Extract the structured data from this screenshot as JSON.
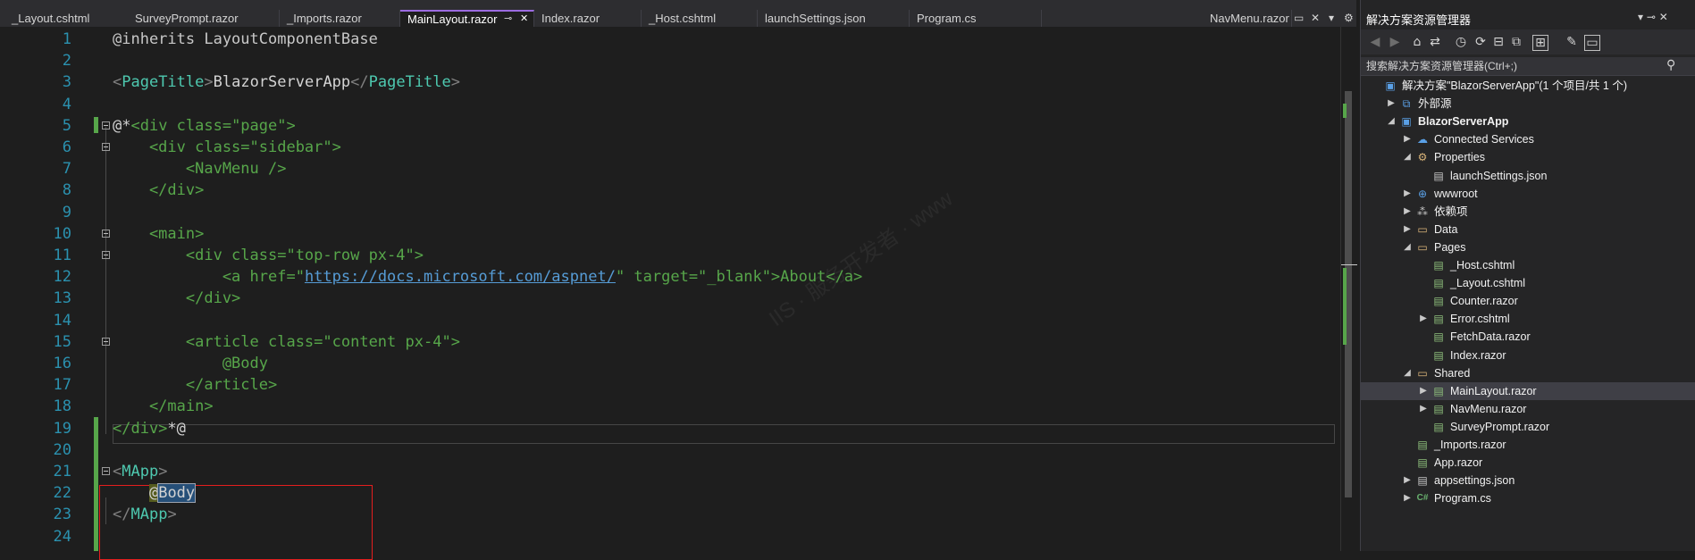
{
  "tabs": [
    {
      "label": "_Layout.cshtml",
      "active": false
    },
    {
      "label": "SurveyPrompt.razor",
      "active": false
    },
    {
      "label": "_Imports.razor",
      "active": false
    },
    {
      "label": "MainLayout.razor",
      "active": true
    },
    {
      "label": "Index.razor",
      "active": false
    },
    {
      "label": "_Host.cshtml",
      "active": false
    },
    {
      "label": "launchSettings.json",
      "active": false
    },
    {
      "label": "Program.cs",
      "active": false
    },
    {
      "label": "NavMenu.razor",
      "active": false
    }
  ],
  "tab_controls": {
    "pin": "⊸",
    "close": "✕",
    "float": "▭",
    "dropdown": "▾",
    "settings": "⚙"
  },
  "code_lines": [
    {
      "n": "1",
      "segs": [
        {
          "t": "@inherits LayoutComponentBase",
          "c": "t-kw"
        }
      ]
    },
    {
      "n": "2",
      "segs": []
    },
    {
      "n": "3",
      "segs": [
        {
          "t": "<",
          "c": "t-delim"
        },
        {
          "t": "PageTitle",
          "c": "t-comp"
        },
        {
          "t": ">",
          "c": "t-delim"
        },
        {
          "t": "BlazorServerApp",
          "c": "t-muted"
        },
        {
          "t": "</",
          "c": "t-delim"
        },
        {
          "t": "PageTitle",
          "c": "t-comp"
        },
        {
          "t": ">",
          "c": "t-delim"
        }
      ]
    },
    {
      "n": "4",
      "segs": []
    },
    {
      "n": "5",
      "segs": [
        {
          "t": "@*",
          "c": "t-muted"
        },
        {
          "t": "<div class=\"page\">",
          "c": "t-com"
        }
      ]
    },
    {
      "n": "6",
      "segs": [
        {
          "t": "    <div class=\"sidebar\">",
          "c": "t-com"
        }
      ]
    },
    {
      "n": "7",
      "segs": [
        {
          "t": "        <NavMenu />",
          "c": "t-com"
        }
      ]
    },
    {
      "n": "8",
      "segs": [
        {
          "t": "    </div>",
          "c": "t-com"
        }
      ]
    },
    {
      "n": "9",
      "segs": []
    },
    {
      "n": "10",
      "segs": [
        {
          "t": "    <main>",
          "c": "t-com"
        }
      ]
    },
    {
      "n": "11",
      "segs": [
        {
          "t": "        <div class=\"top-row px-4\">",
          "c": "t-com"
        }
      ]
    },
    {
      "n": "12",
      "segs": [
        {
          "t": "            <a href=\"",
          "c": "t-com"
        },
        {
          "t": "https://docs.microsoft.com/aspnet/",
          "c": "t-link"
        },
        {
          "t": "\" target=\"_blank\">About</a>",
          "c": "t-com"
        }
      ]
    },
    {
      "n": "13",
      "segs": [
        {
          "t": "        </div>",
          "c": "t-com"
        }
      ]
    },
    {
      "n": "14",
      "segs": []
    },
    {
      "n": "15",
      "segs": [
        {
          "t": "        <article class=\"content px-4\">",
          "c": "t-com"
        }
      ]
    },
    {
      "n": "16",
      "segs": [
        {
          "t": "            @Body",
          "c": "t-com"
        }
      ]
    },
    {
      "n": "17",
      "segs": [
        {
          "t": "        </article>",
          "c": "t-com"
        }
      ]
    },
    {
      "n": "18",
      "segs": [
        {
          "t": "    </main>",
          "c": "t-com"
        }
      ]
    },
    {
      "n": "19",
      "segs": [
        {
          "t": "</div>",
          "c": "t-com"
        },
        {
          "t": "*@",
          "c": "t-muted"
        }
      ]
    },
    {
      "n": "20",
      "segs": []
    },
    {
      "n": "21",
      "segs": [
        {
          "t": "<",
          "c": "t-delim"
        },
        {
          "t": "MApp",
          "c": "t-comp"
        },
        {
          "t": ">",
          "c": "t-delim"
        }
      ]
    },
    {
      "n": "22",
      "segs": [
        {
          "t": "    ",
          "c": "t-muted"
        },
        {
          "t": "@",
          "c": "t-atbg"
        },
        {
          "t": "Body",
          "c": "t-sel"
        }
      ]
    },
    {
      "n": "23",
      "segs": [
        {
          "t": "</",
          "c": "t-delim"
        },
        {
          "t": "MApp",
          "c": "t-comp"
        },
        {
          "t": ">",
          "c": "t-delim"
        }
      ]
    },
    {
      "n": "24",
      "segs": []
    }
  ],
  "solution_explorer": {
    "title": "解决方案资源管理器",
    "controls": "▾  ⊸  ✕",
    "search_placeholder": "搜索解决方案资源管理器(Ctrl+;)",
    "toolbar_icons": [
      {
        "name": "back-icon",
        "g": "◀",
        "dim": true
      },
      {
        "name": "forward-icon",
        "g": "▶",
        "dim": true
      },
      {
        "name": "home-icon",
        "g": "⌂"
      },
      {
        "name": "switch-views-icon",
        "g": "⇄"
      },
      {
        "name": "history-icon",
        "g": "◷"
      },
      {
        "name": "sync-icon",
        "g": "⟳"
      },
      {
        "name": "collapse-all-icon",
        "g": "⊟"
      },
      {
        "name": "show-all-files-icon",
        "g": "⧉"
      },
      {
        "name": "tree-view-icon",
        "g": "⊞",
        "boxed": true
      },
      {
        "name": "properties-icon",
        "g": "✎"
      },
      {
        "name": "preview-icon",
        "g": "▭",
        "boxed": true
      }
    ],
    "tree": [
      {
        "label": "解决方案\"BlazorServerApp\"(1 个项目/共 1 个)",
        "level": 0,
        "arrow": "",
        "icon": "▣",
        "ic": "ic-proj"
      },
      {
        "label": "外部源",
        "level": 1,
        "arrow": "▶",
        "icon": "⧉",
        "ic": "ic-proj"
      },
      {
        "label": "BlazorServerApp",
        "level": 1,
        "arrow": "◢",
        "icon": "▣",
        "ic": "ic-proj",
        "bold": true
      },
      {
        "label": "Connected Services",
        "level": 2,
        "arrow": "▶",
        "icon": "☁",
        "ic": "ic-globe"
      },
      {
        "label": "Properties",
        "level": 2,
        "arrow": "◢",
        "icon": "⚙",
        "ic": "ic-folder"
      },
      {
        "label": "launchSettings.json",
        "level": 3,
        "arrow": "",
        "icon": "▤",
        "ic": "ic-file"
      },
      {
        "label": "wwwroot",
        "level": 2,
        "arrow": "▶",
        "icon": "⊕",
        "ic": "ic-globe"
      },
      {
        "label": "依赖项",
        "level": 2,
        "arrow": "▶",
        "icon": "⁂",
        "ic": "ic-file"
      },
      {
        "label": "Data",
        "level": 2,
        "arrow": "▶",
        "icon": "▭",
        "ic": "ic-folder"
      },
      {
        "label": "Pages",
        "level": 2,
        "arrow": "◢",
        "icon": "▭",
        "ic": "ic-folder"
      },
      {
        "label": "_Host.cshtml",
        "level": 3,
        "arrow": "",
        "icon": "▤",
        "ic": "ic-razor"
      },
      {
        "label": "_Layout.cshtml",
        "level": 3,
        "arrow": "",
        "icon": "▤",
        "ic": "ic-razor"
      },
      {
        "label": "Counter.razor",
        "level": 3,
        "arrow": "",
        "icon": "▤",
        "ic": "ic-razor"
      },
      {
        "label": "Error.cshtml",
        "level": 3,
        "arrow": "▶",
        "icon": "▤",
        "ic": "ic-razor"
      },
      {
        "label": "FetchData.razor",
        "level": 3,
        "arrow": "",
        "icon": "▤",
        "ic": "ic-razor"
      },
      {
        "label": "Index.razor",
        "level": 3,
        "arrow": "",
        "icon": "▤",
        "ic": "ic-razor"
      },
      {
        "label": "Shared",
        "level": 2,
        "arrow": "◢",
        "icon": "▭",
        "ic": "ic-folder"
      },
      {
        "label": "MainLayout.razor",
        "level": 3,
        "arrow": "▶",
        "icon": "▤",
        "ic": "ic-razor",
        "selected": true
      },
      {
        "label": "NavMenu.razor",
        "level": 3,
        "arrow": "▶",
        "icon": "▤",
        "ic": "ic-razor"
      },
      {
        "label": "SurveyPrompt.razor",
        "level": 3,
        "arrow": "",
        "icon": "▤",
        "ic": "ic-razor"
      },
      {
        "label": "_Imports.razor",
        "level": 2,
        "arrow": "",
        "icon": "▤",
        "ic": "ic-razor"
      },
      {
        "label": "App.razor",
        "level": 2,
        "arrow": "",
        "icon": "▤",
        "ic": "ic-razor"
      },
      {
        "label": "appsettings.json",
        "level": 2,
        "arrow": "▶",
        "icon": "▤",
        "ic": "ic-file"
      },
      {
        "label": "Program.cs",
        "level": 2,
        "arrow": "▶",
        "icon": "C#",
        "ic": "ic-cs"
      }
    ]
  },
  "watermark": "IIS · 服务开发者 · www"
}
